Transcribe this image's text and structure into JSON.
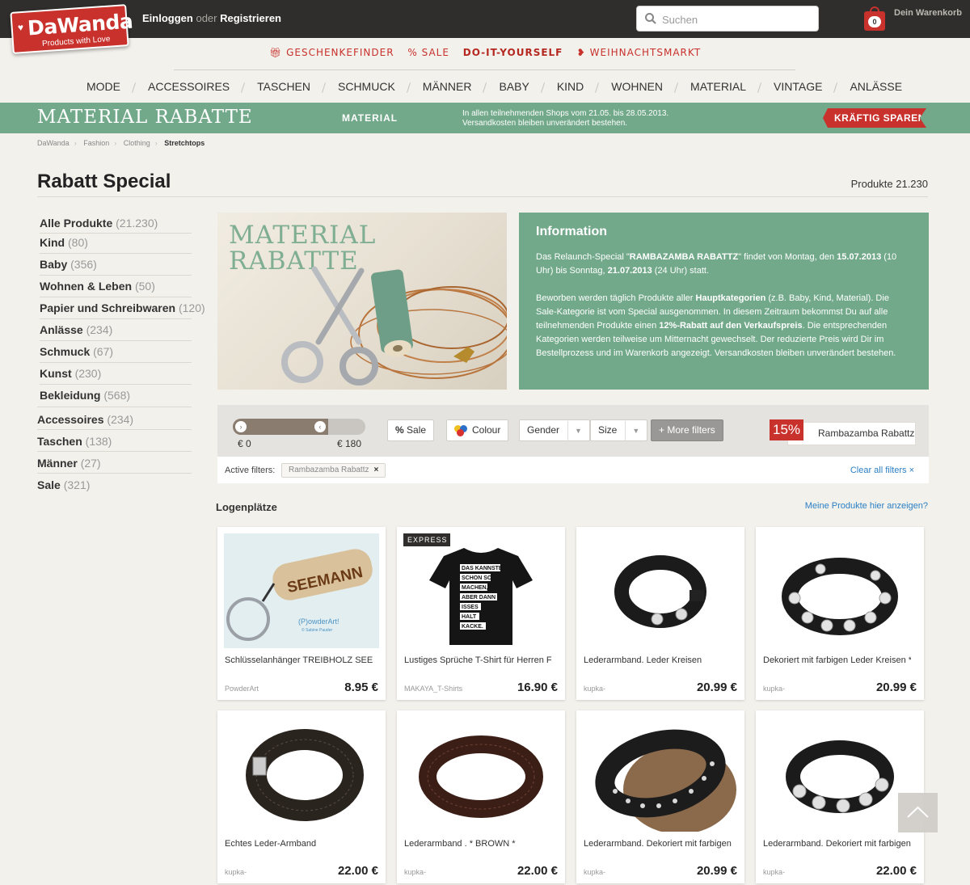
{
  "header": {
    "logo_brand": "DaWanda",
    "logo_tagline": "Products with Love",
    "login": "Einloggen",
    "or": "oder",
    "register": "Registrieren",
    "search_placeholder": "Suchen",
    "cart_count": "0",
    "cart_label": "Dein Warenkorb"
  },
  "submenu": [
    {
      "label": "Geschenkefinder",
      "icon": "gift-icon"
    },
    {
      "label": "% Sale",
      "icon": ""
    },
    {
      "label": "Do-it-yourself",
      "icon": ""
    },
    {
      "label": "Weihnachtsmarkt",
      "icon": "hearts-icon"
    }
  ],
  "nav": [
    "MODE",
    "ACCESSOIRES",
    "TASCHEN",
    "SCHMUCK",
    "MÄNNER",
    "BABY",
    "KIND",
    "WOHNEN",
    "MATERIAL",
    "VINTAGE",
    "ANLÄSSE"
  ],
  "banner": {
    "title": "MATERIAL RABATTE",
    "category": "MATERIAL",
    "info_line1": "In allen teilnehmenden Shops vom 21.05. bis 28.05.2013.",
    "info_line2": "Versandkosten bleiben unverändert bestehen.",
    "cta": "KRÄFTIG SPAREN"
  },
  "breadcrumb": [
    "DaWanda",
    "Fashion",
    "Clothing",
    "Stretchtops"
  ],
  "page": {
    "title": "Rabatt Special",
    "count": "Produkte 21.230"
  },
  "sidebar": [
    {
      "label": "Alle Produkte",
      "count": "(21.230)"
    },
    {
      "label": "Kind",
      "count": "(80)"
    },
    {
      "label": "Baby",
      "count": "(356)"
    },
    {
      "label": "Wohnen & Leben",
      "count": "(50)"
    },
    {
      "label": "Papier und Schreibwaren",
      "count": "(120)"
    },
    {
      "label": "Anlässe",
      "count": "(234)"
    },
    {
      "label": "Schmuck",
      "count": "(67)"
    },
    {
      "label": "Kunst",
      "count": "(230)"
    },
    {
      "label": "Bekleidung",
      "count": "(568)"
    },
    {
      "label": "Accessoires",
      "count": "(234)"
    },
    {
      "label": "Taschen",
      "count": "(138)"
    },
    {
      "label": "Männer",
      "count": "(27)"
    },
    {
      "label": "Sale",
      "count": "(321)"
    }
  ],
  "hero": {
    "line1": "MATERIAL",
    "line2": "RABATTE"
  },
  "info": {
    "heading": "Information",
    "p1_a": "Das Relaunch-Special \"",
    "p1_b": "RAMBAZAMBA RABATTZ",
    "p1_c": "\" findet von Montag, den ",
    "p1_d": "15.07.2013",
    "p1_e": " (10 Uhr) bis Sonntag, ",
    "p1_f": "21.07.2013",
    "p1_g": " (24 Uhr) statt.",
    "p2_a": "Beworben werden täglich Produkte aller ",
    "p2_b": "Hauptkategorien",
    "p2_c": " (z.B. Baby, Kind, Material). Die Sale-Kategorie ist vom Special ausgenommen. In diesem Zeitraum bekommst Du auf alle teilnehmenden Produkte einen ",
    "p2_d": "12%-Rabatt auf den Verkaufspreis",
    "p2_e": ". Die entsprechenden Kategorien werden teilweise um Mitternacht gewechselt. Der reduzierte Preis wird Dir im Bestellprozess und im Warenkorb angezeigt. Versandkosten bleiben unverändert bestehen."
  },
  "filters": {
    "price_min": "€ 0",
    "price_max": "€ 180",
    "price_min_fraction": 0.0,
    "price_max_fraction": 0.68,
    "sale": "Sale",
    "colour": "Colour",
    "gender": "Gender",
    "size": "Size",
    "more": "More filters",
    "rabatt_percent": "15%",
    "rabatt_label": "Rambazamba Rabattz",
    "active_label": "Active filters:",
    "active_chip": "Rambazamba Rabattz",
    "clear_all": "Clear all filters ×"
  },
  "section": {
    "title": "Logenplätze",
    "link": "Meine Produkte hier anzeigen?"
  },
  "products": [
    {
      "title": "Schlüsselanhänger TREIBHOLZ SEEMANN",
      "shop": "PowderArt",
      "price": "8.95 €",
      "express": ""
    },
    {
      "title": "Lustiges Sprüche T-Shirt für Herren FUN",
      "shop": "MAKAYA_T-Shirts",
      "price": "16.90 €",
      "express": "EXPRESS"
    },
    {
      "title": "Lederarmband. Leder Kreisen",
      "shop": "kupka-",
      "price": "20.99 €",
      "express": ""
    },
    {
      "title": "Dekoriert mit farbigen Leder Kreisen *",
      "shop": "kupka-",
      "price": "20.99 €",
      "express": ""
    },
    {
      "title": "Echtes Leder-Armband",
      "shop": "kupka-",
      "price": "22.00 €",
      "express": ""
    },
    {
      "title": "Lederarmband . * BROWN *",
      "shop": "kupka-",
      "price": "22.00 €",
      "express": ""
    },
    {
      "title": "Lederarmband. Dekoriert mit farbigen",
      "shop": "kupka-",
      "price": "20.99 €",
      "express": ""
    },
    {
      "title": "Lederarmband. Dekoriert mit farbigen L",
      "shop": "kupka-",
      "price": "22.00 €",
      "express": ""
    }
  ],
  "product_images": {
    "keychain_text": "SEEMANN",
    "keychain_brand": "(P)owderArt!",
    "keychain_sub": "© Sabine Pauder",
    "shirt_lines": [
      "DAS KANNSTE",
      "SCHON SO",
      "MACHEN,",
      "ABER DANN",
      "ISSES",
      "HALT",
      "KACKE."
    ]
  },
  "colors": {
    "accent_red": "#c8312c",
    "banner_green": "#72a98a",
    "topbar": "#2f2e2c",
    "link_blue": "#2a7fc4"
  }
}
